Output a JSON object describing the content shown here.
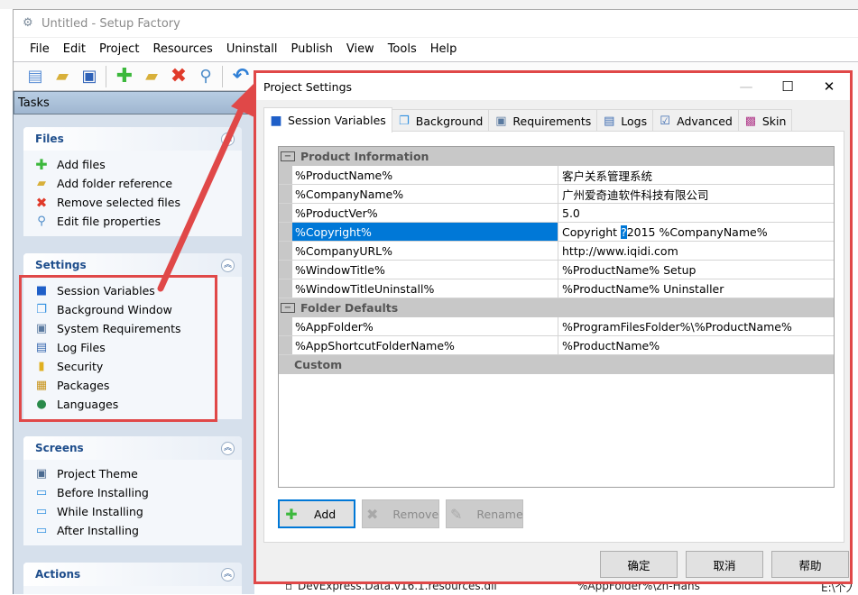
{
  "app": {
    "title": "Untitled - Setup Factory",
    "menu": [
      "File",
      "Edit",
      "Project",
      "Resources",
      "Uninstall",
      "Publish",
      "View",
      "Tools",
      "Help"
    ],
    "toolbar": [
      {
        "icon": "new-project-icon",
        "glyph": "🗋",
        "color": "#5b8fd6"
      },
      {
        "icon": "open-project-icon",
        "glyph": "📂",
        "color": "#d8b03a"
      },
      {
        "icon": "save-icon",
        "glyph": "💾",
        "color": "#2f62b8"
      },
      {
        "icon": "add-files-icon",
        "glyph": "✚",
        "color": "#3cb83c"
      },
      {
        "icon": "add-folder-icon",
        "glyph": "📁",
        "color": "#d8b03a"
      },
      {
        "icon": "remove-icon",
        "glyph": "✖",
        "color": "#e03a2a"
      },
      {
        "icon": "search-icon",
        "glyph": "🔍",
        "color": "#4a8ac8"
      },
      {
        "icon": "undo-icon",
        "glyph": "↶",
        "color": "#2f7fd6"
      }
    ]
  },
  "tasks": {
    "header": "Tasks",
    "groups": [
      {
        "title": "Files",
        "items": [
          {
            "label": "Add files",
            "icon": "add-icon",
            "glyph": "✚",
            "color": "#3cb83c"
          },
          {
            "label": "Add folder reference",
            "icon": "folder-add-icon",
            "glyph": "📁",
            "color": "#d8b03a"
          },
          {
            "label": "Remove selected files",
            "icon": "remove-icon",
            "glyph": "✖",
            "color": "#e03a2a"
          },
          {
            "label": "Edit file properties",
            "icon": "search-icon",
            "glyph": "🔍",
            "color": "#4a8ac8"
          }
        ]
      },
      {
        "title": "Settings",
        "items": [
          {
            "label": "Session Variables",
            "icon": "session-variables-icon",
            "glyph": "■",
            "color": "#1f5fc8"
          },
          {
            "label": "Background Window",
            "icon": "background-window-icon",
            "glyph": "❐",
            "color": "#2f8fe0"
          },
          {
            "label": "System Requirements",
            "icon": "system-requirements-icon",
            "glyph": "▣",
            "color": "#5a7aa0"
          },
          {
            "label": "Log Files",
            "icon": "log-files-icon",
            "glyph": "▤",
            "color": "#3a6ab0"
          },
          {
            "label": "Security",
            "icon": "lock-icon",
            "glyph": "🔒",
            "color": "#e0b020"
          },
          {
            "label": "Packages",
            "icon": "packages-icon",
            "glyph": "▦",
            "color": "#c8941c"
          },
          {
            "label": "Languages",
            "icon": "globe-icon",
            "glyph": "●",
            "color": "#2a8a4a"
          }
        ]
      },
      {
        "title": "Screens",
        "items": [
          {
            "label": "Project Theme",
            "icon": "project-theme-icon",
            "glyph": "▣",
            "color": "#4a6a90"
          },
          {
            "label": "Before Installing",
            "icon": "screen-icon",
            "glyph": "▭",
            "color": "#2f8fe0"
          },
          {
            "label": "While Installing",
            "icon": "screen-gear-icon",
            "glyph": "▭",
            "color": "#2f8fe0"
          },
          {
            "label": "After Installing",
            "icon": "screen-icon",
            "glyph": "▭",
            "color": "#2f8fe0"
          }
        ]
      },
      {
        "title": "Actions",
        "items": []
      }
    ]
  },
  "background_list": {
    "row": {
      "file": "DevExpress.Data.v16.1.resources.dll",
      "destination": "%AppFolder%\\zh-Hans",
      "source": "E:\\个人应用程序"
    }
  },
  "dialog": {
    "title": "Project Settings",
    "tabs": [
      {
        "label": "Session Variables",
        "icon": "session-variables-icon",
        "active": true
      },
      {
        "label": "Background",
        "icon": "background-icon",
        "active": false
      },
      {
        "label": "Requirements",
        "icon": "requirements-icon",
        "active": false
      },
      {
        "label": "Logs",
        "icon": "logs-icon",
        "active": false
      },
      {
        "label": "Advanced",
        "icon": "advanced-icon",
        "active": false
      },
      {
        "label": "Skin",
        "icon": "skin-icon",
        "active": false
      }
    ],
    "categories": [
      {
        "label": "Product Information",
        "collapsible": true,
        "rows": [
          {
            "name": "%ProductName%",
            "value": "客户关系管理系统"
          },
          {
            "name": "%CompanyName%",
            "value": "广州爱奇迪软件科技有限公司"
          },
          {
            "name": "%ProductVer%",
            "value": "5.0"
          },
          {
            "name": "%Copyright%",
            "value_before": "Copyright ",
            "value_sel": "?",
            "value_after": "2015 %CompanyName%",
            "selected": true
          },
          {
            "name": "%CompanyURL%",
            "value": "http://www.iqidi.com"
          },
          {
            "name": "%WindowTitle%",
            "value": "%ProductName% Setup"
          },
          {
            "name": "%WindowTitleUninstall%",
            "value": "%ProductName% Uninstaller"
          }
        ]
      },
      {
        "label": "Folder Defaults",
        "collapsible": true,
        "rows": [
          {
            "name": "%AppFolder%",
            "value": "%ProgramFilesFolder%\\%ProductName%"
          },
          {
            "name": "%AppShortcutFolderName%",
            "value": "%ProductName%"
          }
        ]
      },
      {
        "label": "Custom",
        "collapsible": false,
        "rows": []
      }
    ],
    "page_buttons": {
      "add": "Add",
      "remove": "Remove",
      "rename": "Rename"
    },
    "footer": {
      "ok": "确定",
      "cancel": "取消",
      "help": "帮助"
    },
    "window_buttons": {
      "minimize": "—",
      "maximize": "☐",
      "close": "✕"
    }
  },
  "annotation": {
    "color": "#e04848"
  }
}
